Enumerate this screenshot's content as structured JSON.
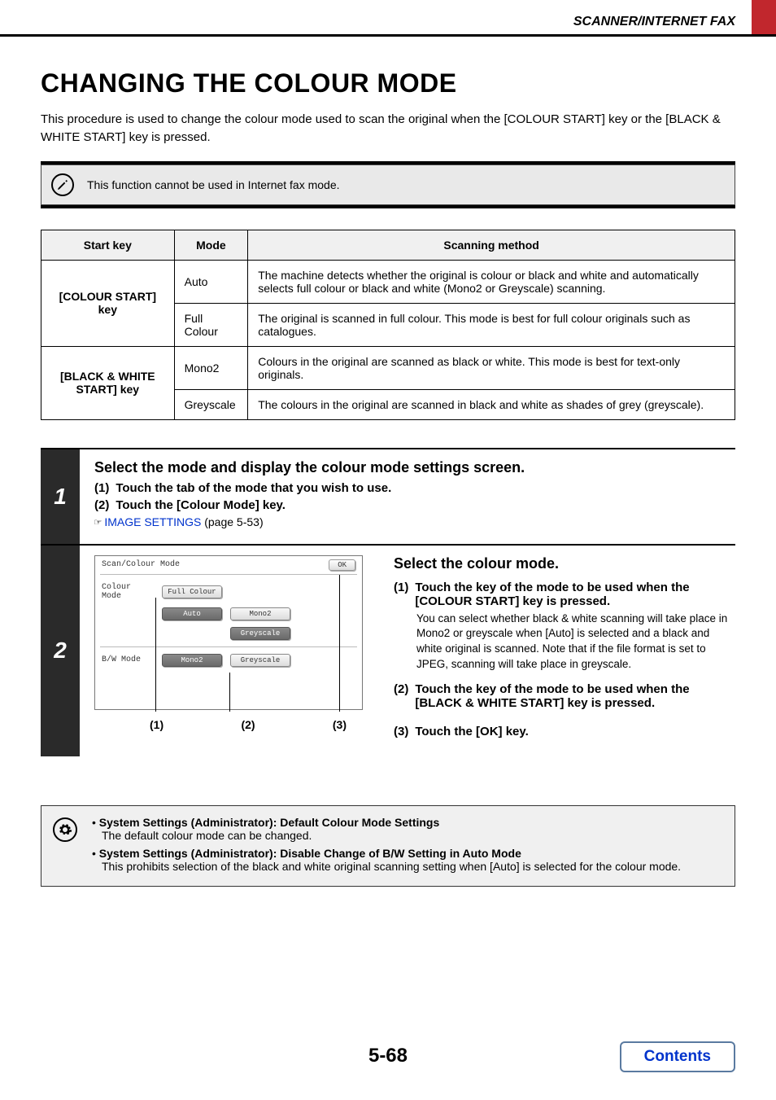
{
  "header": {
    "section": "SCANNER/INTERNET FAX"
  },
  "title": "CHANGING THE COLOUR MODE",
  "intro": "This procedure is used to change the colour mode used to scan the original when the [COLOUR START] key or the [BLACK & WHITE START] key is pressed.",
  "note": "This function cannot be used in Internet fax mode.",
  "table": {
    "headers": [
      "Start key",
      "Mode",
      "Scanning method"
    ],
    "rows": [
      {
        "key": "[COLOUR START] key",
        "mode": "Auto",
        "method": "The machine detects whether the original is colour or black and white and automatically selects full colour or black and white (Mono2 or Greyscale) scanning."
      },
      {
        "key": "",
        "mode": "Full Colour",
        "method": "The original is scanned in full colour. This mode is best for full colour originals such as catalogues."
      },
      {
        "key": "[BLACK & WHITE START] key",
        "mode": "Mono2",
        "method": "Colours in the original are scanned as black or white. This mode is best for text-only originals."
      },
      {
        "key": "",
        "mode": "Greyscale",
        "method": "The colours in the original are scanned in black and white as shades of grey (greyscale)."
      }
    ]
  },
  "step1": {
    "num": "1",
    "heading": "Select the mode and display the colour mode settings screen.",
    "items": [
      {
        "n": "(1)",
        "text": "Touch the tab of the mode that you wish to use."
      },
      {
        "n": "(2)",
        "text": "Touch the [Colour Mode] key."
      }
    ],
    "link_icon": "☞",
    "link_text": "IMAGE SETTINGS",
    "link_page": " (page 5-53)"
  },
  "step2": {
    "num": "2",
    "panel": {
      "title": "Scan/Colour Mode",
      "ok": "OK",
      "row1_label": "Colour Mode",
      "row1_btns": [
        "Full Colour",
        "Auto",
        "Mono2",
        "Greyscale"
      ],
      "row2_label": "B/W Mode",
      "row2_btns": [
        "Mono2",
        "Greyscale"
      ]
    },
    "callouts": [
      "(1)",
      "(2)",
      "(3)"
    ],
    "heading": "Select the colour mode.",
    "items": [
      {
        "n": "(1)",
        "text": "Touch the key of the mode to be used when the [COLOUR START] key is pressed.",
        "sub": "You can select whether black & white scanning will take place in Mono2 or greyscale when [Auto] is selected and a black and white original is scanned. Note that if the file format is set to JPEG, scanning will take place in greyscale."
      },
      {
        "n": "(2)",
        "text": "Touch the key of the mode to be used when the [BLACK & WHITE START] key is pressed."
      },
      {
        "n": "(3)",
        "text": "Touch the [OK] key."
      }
    ]
  },
  "admin": [
    {
      "hdr": "System Settings (Administrator): Default Colour Mode Settings",
      "desc": "The default colour mode can be changed."
    },
    {
      "hdr": "System Settings (Administrator): Disable Change of B/W Setting in Auto Mode",
      "desc": "This prohibits selection of the black and white original scanning setting when [Auto] is selected for the colour mode."
    }
  ],
  "footer": {
    "page": "5-68",
    "contents": "Contents"
  }
}
